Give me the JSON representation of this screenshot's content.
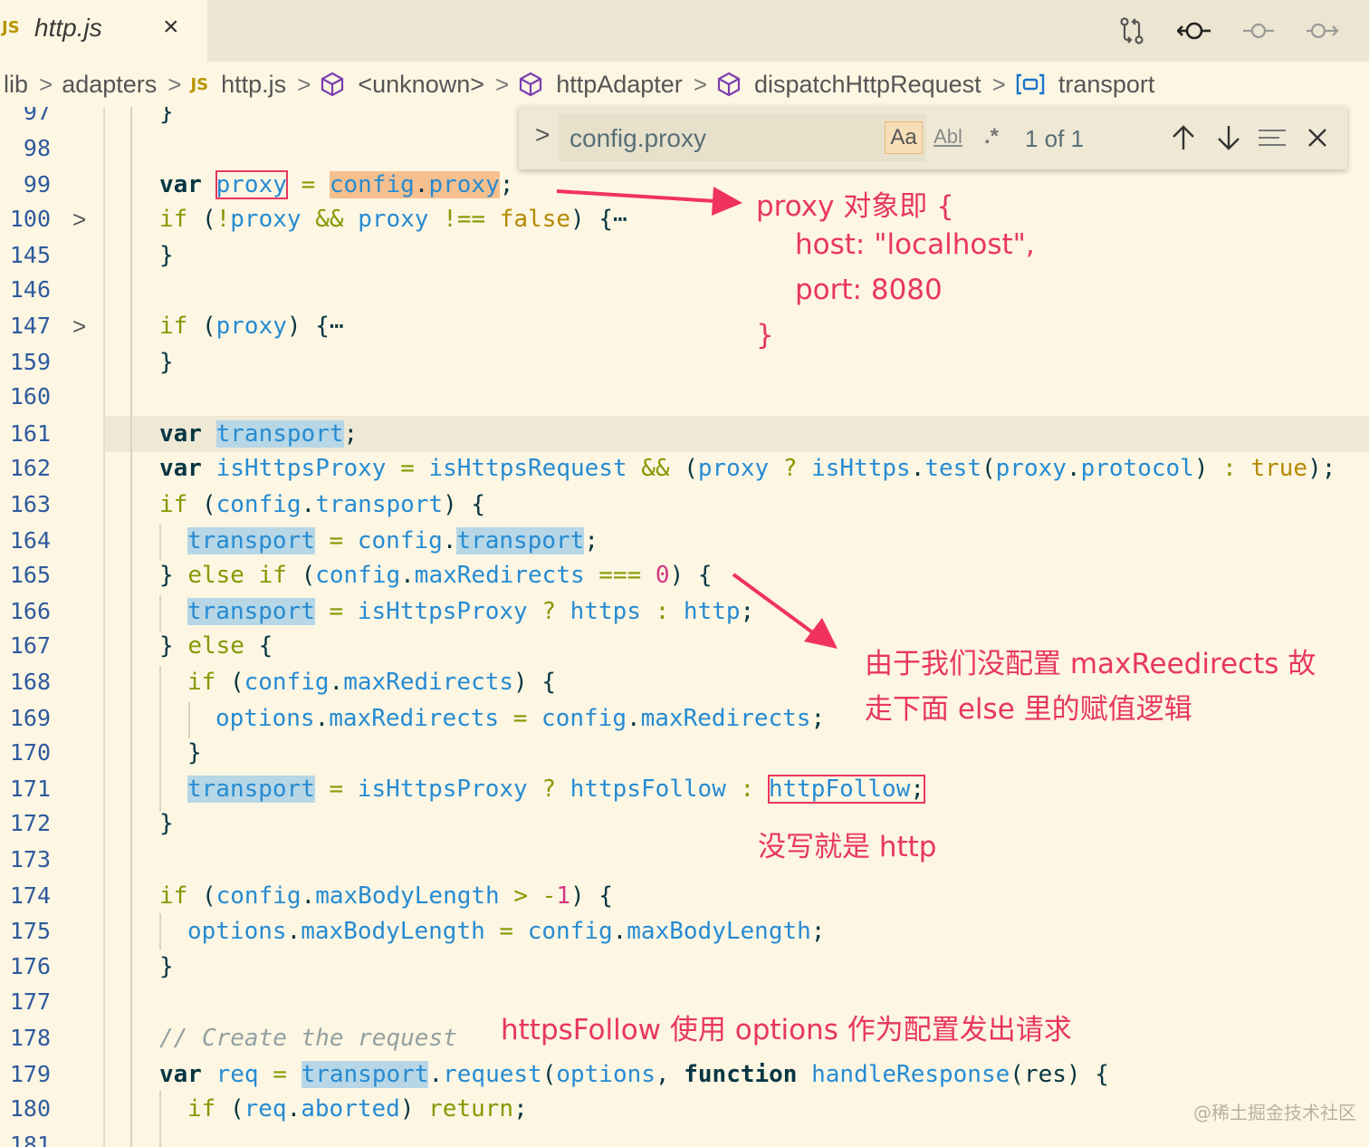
{
  "tab": {
    "lang_badge": "JS",
    "file_name": "http.js",
    "close_glyph": "×"
  },
  "toolbar_icons": [
    "source-control-compare-icon",
    "git-commit-icon",
    "git-commit-previous-icon",
    "git-commit-next-icon"
  ],
  "breadcrumb": [
    {
      "label": "lib",
      "icon": null
    },
    {
      "label": "adapters",
      "icon": null
    },
    {
      "label": "http.js",
      "icon": "JS"
    },
    {
      "label": "<unknown>",
      "icon": "cube-icon"
    },
    {
      "label": "httpAdapter",
      "icon": "cube-icon"
    },
    {
      "label": "dispatchHttpRequest",
      "icon": "cube-icon"
    },
    {
      "label": "transport",
      "icon": "variable-icon"
    }
  ],
  "find_widget": {
    "query": "config.proxy",
    "match_case": "Aa",
    "whole_word": "Abl",
    "regex": ".*",
    "match_count": "1 of 1"
  },
  "line_numbers": [
    "97",
    "98",
    "99",
    "100",
    "145",
    "146",
    "147",
    "159",
    "160",
    "161",
    "162",
    "163",
    "164",
    "165",
    "166",
    "167",
    "168",
    "169",
    "170",
    "171",
    "172",
    "173",
    "174",
    "175",
    "176",
    "177",
    "178",
    "179",
    "180",
    "181"
  ],
  "folded_lines": [
    "100",
    "147"
  ],
  "code_lines": {
    "l97": "}",
    "l98": "",
    "l99": "var proxy = config.proxy;",
    "l100": "if (!proxy && proxy !== false) {⋯",
    "l145": "}",
    "l147": "if (proxy) {⋯",
    "l159": "}",
    "l161": "var transport;",
    "l162": "var isHttpsProxy = isHttpsRequest && (proxy ? isHttps.test(proxy.protocol) : true);",
    "l163": "if (config.transport) {",
    "l164": "transport = config.transport;",
    "l165": "} else if (config.maxRedirects === 0) {",
    "l166": "transport = isHttpsProxy ? https : http;",
    "l167": "} else {",
    "l168": "if (config.maxRedirects) {",
    "l169": "options.maxRedirects = config.maxRedirects;",
    "l170": "}",
    "l171": "transport = isHttpsProxy ? httpsFollow : httpFollow;",
    "l172": "}",
    "l174": "if (config.maxBodyLength > -1) {",
    "l175": "options.maxBodyLength = config.maxBodyLength;",
    "l176": "}",
    "l178": "// Create the request",
    "l179": "var req = transport.request(options, function handleResponse(res) {",
    "l180": "if (req.aborted) return;"
  },
  "annotations": {
    "proxy_line1": "proxy 对象即 {",
    "proxy_line2": "host: \"localhost\",",
    "proxy_line3": "port: 8080",
    "proxy_line4": "}",
    "redirect_line1": "由于我们没配置 maxReedirects 故",
    "redirect_line2": "走下面 else 里的赋值逻辑",
    "http_note": "没写就是 http",
    "follow_note": "httpsFollow 使用 options 作为配置发出请求"
  },
  "watermark": "@稀土掘金技术社区",
  "colors": {
    "background": "#fdf6e3",
    "annotation": "#e8375e",
    "keyword": "#073642",
    "identifier": "#268bd2",
    "control": "#859900",
    "literal": "#b58900",
    "number": "#d33682",
    "line_number": "#2e5a9e",
    "occurrence_highlight": "#b7d7e6",
    "find_match_highlight": "#f6c08e"
  }
}
